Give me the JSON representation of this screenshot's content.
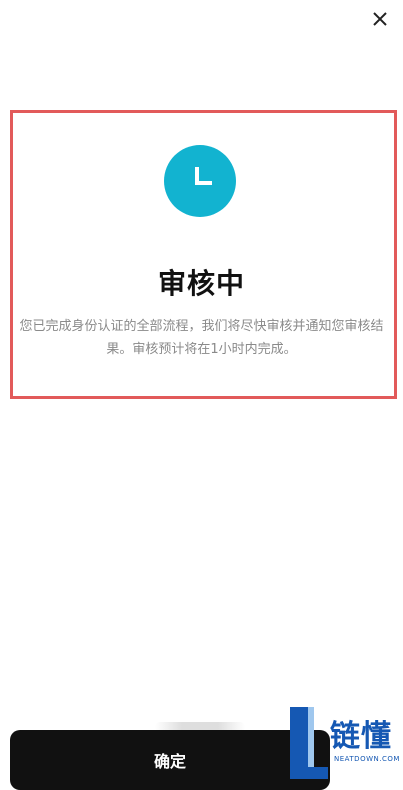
{
  "icons": {
    "close": "close-icon",
    "clock": "clock-icon"
  },
  "colors": {
    "accent": "#12b3d0",
    "highlight_border": "#e25a5a",
    "button_bg": "#111111",
    "watermark": "#1558b3"
  },
  "status": {
    "title": "审核中",
    "description": "您已完成身份认证的全部流程，我们将尽快审核并通知您审核结果。审核预计将在1小时内完成。"
  },
  "footer": {
    "confirm_label": "确定"
  },
  "watermark": {
    "name_cn": "链懂",
    "name_en": "NEATDOWN.COM"
  }
}
